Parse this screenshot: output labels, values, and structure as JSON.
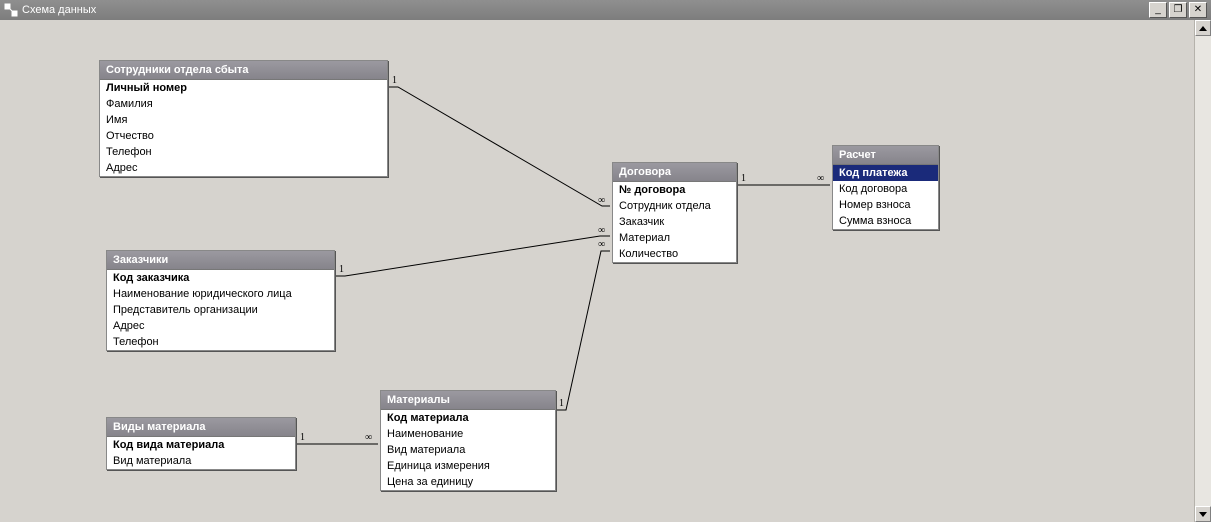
{
  "window": {
    "title": "Схема данных",
    "minimize": "_",
    "restore": "❐",
    "close": "✕"
  },
  "tables": {
    "t1": {
      "title": "Сотрудники отдела сбыта",
      "fields": [
        "Личный номер",
        "Фамилия",
        "Имя",
        "Отчество",
        "Телефон",
        "Адрес"
      ],
      "pk": [
        0
      ]
    },
    "t2": {
      "title": "Заказчики",
      "fields": [
        "Код заказчика",
        "Наименование юридического лица",
        "Представитель организации",
        "Адрес",
        "Телефон"
      ],
      "pk": [
        0
      ]
    },
    "t3": {
      "title": "Виды материала",
      "fields": [
        "Код вида материала",
        "Вид материала"
      ],
      "pk": [
        0
      ]
    },
    "t4": {
      "title": "Материалы",
      "fields": [
        "Код материала",
        "Наименование",
        "Вид материала",
        "Единица измерения",
        "Цена за единицу"
      ],
      "pk": [
        0
      ]
    },
    "t5": {
      "title": "Договора",
      "fields": [
        "№ договора",
        "Сотрудник отдела",
        "Заказчик",
        "Материал",
        "Количество"
      ],
      "pk": [
        0
      ]
    },
    "t6": {
      "title": "Расчет",
      "fields": [
        "Код платежа",
        "Код договора",
        "Номер взноса",
        "Сумма взноса"
      ],
      "pk": [
        0
      ],
      "selected": [
        0
      ]
    }
  },
  "relations": [
    {
      "from": "t1",
      "to": "t5",
      "fromCard": "1",
      "toCard": "∞"
    },
    {
      "from": "t2",
      "to": "t5",
      "fromCard": "1",
      "toCard": "∞"
    },
    {
      "from": "t3",
      "to": "t4",
      "fromCard": "1",
      "toCard": "∞"
    },
    {
      "from": "t4",
      "to": "t5",
      "fromCard": "1",
      "toCard": "∞"
    },
    {
      "from": "t5",
      "to": "t6",
      "fromCard": "1",
      "toCard": "∞"
    }
  ]
}
